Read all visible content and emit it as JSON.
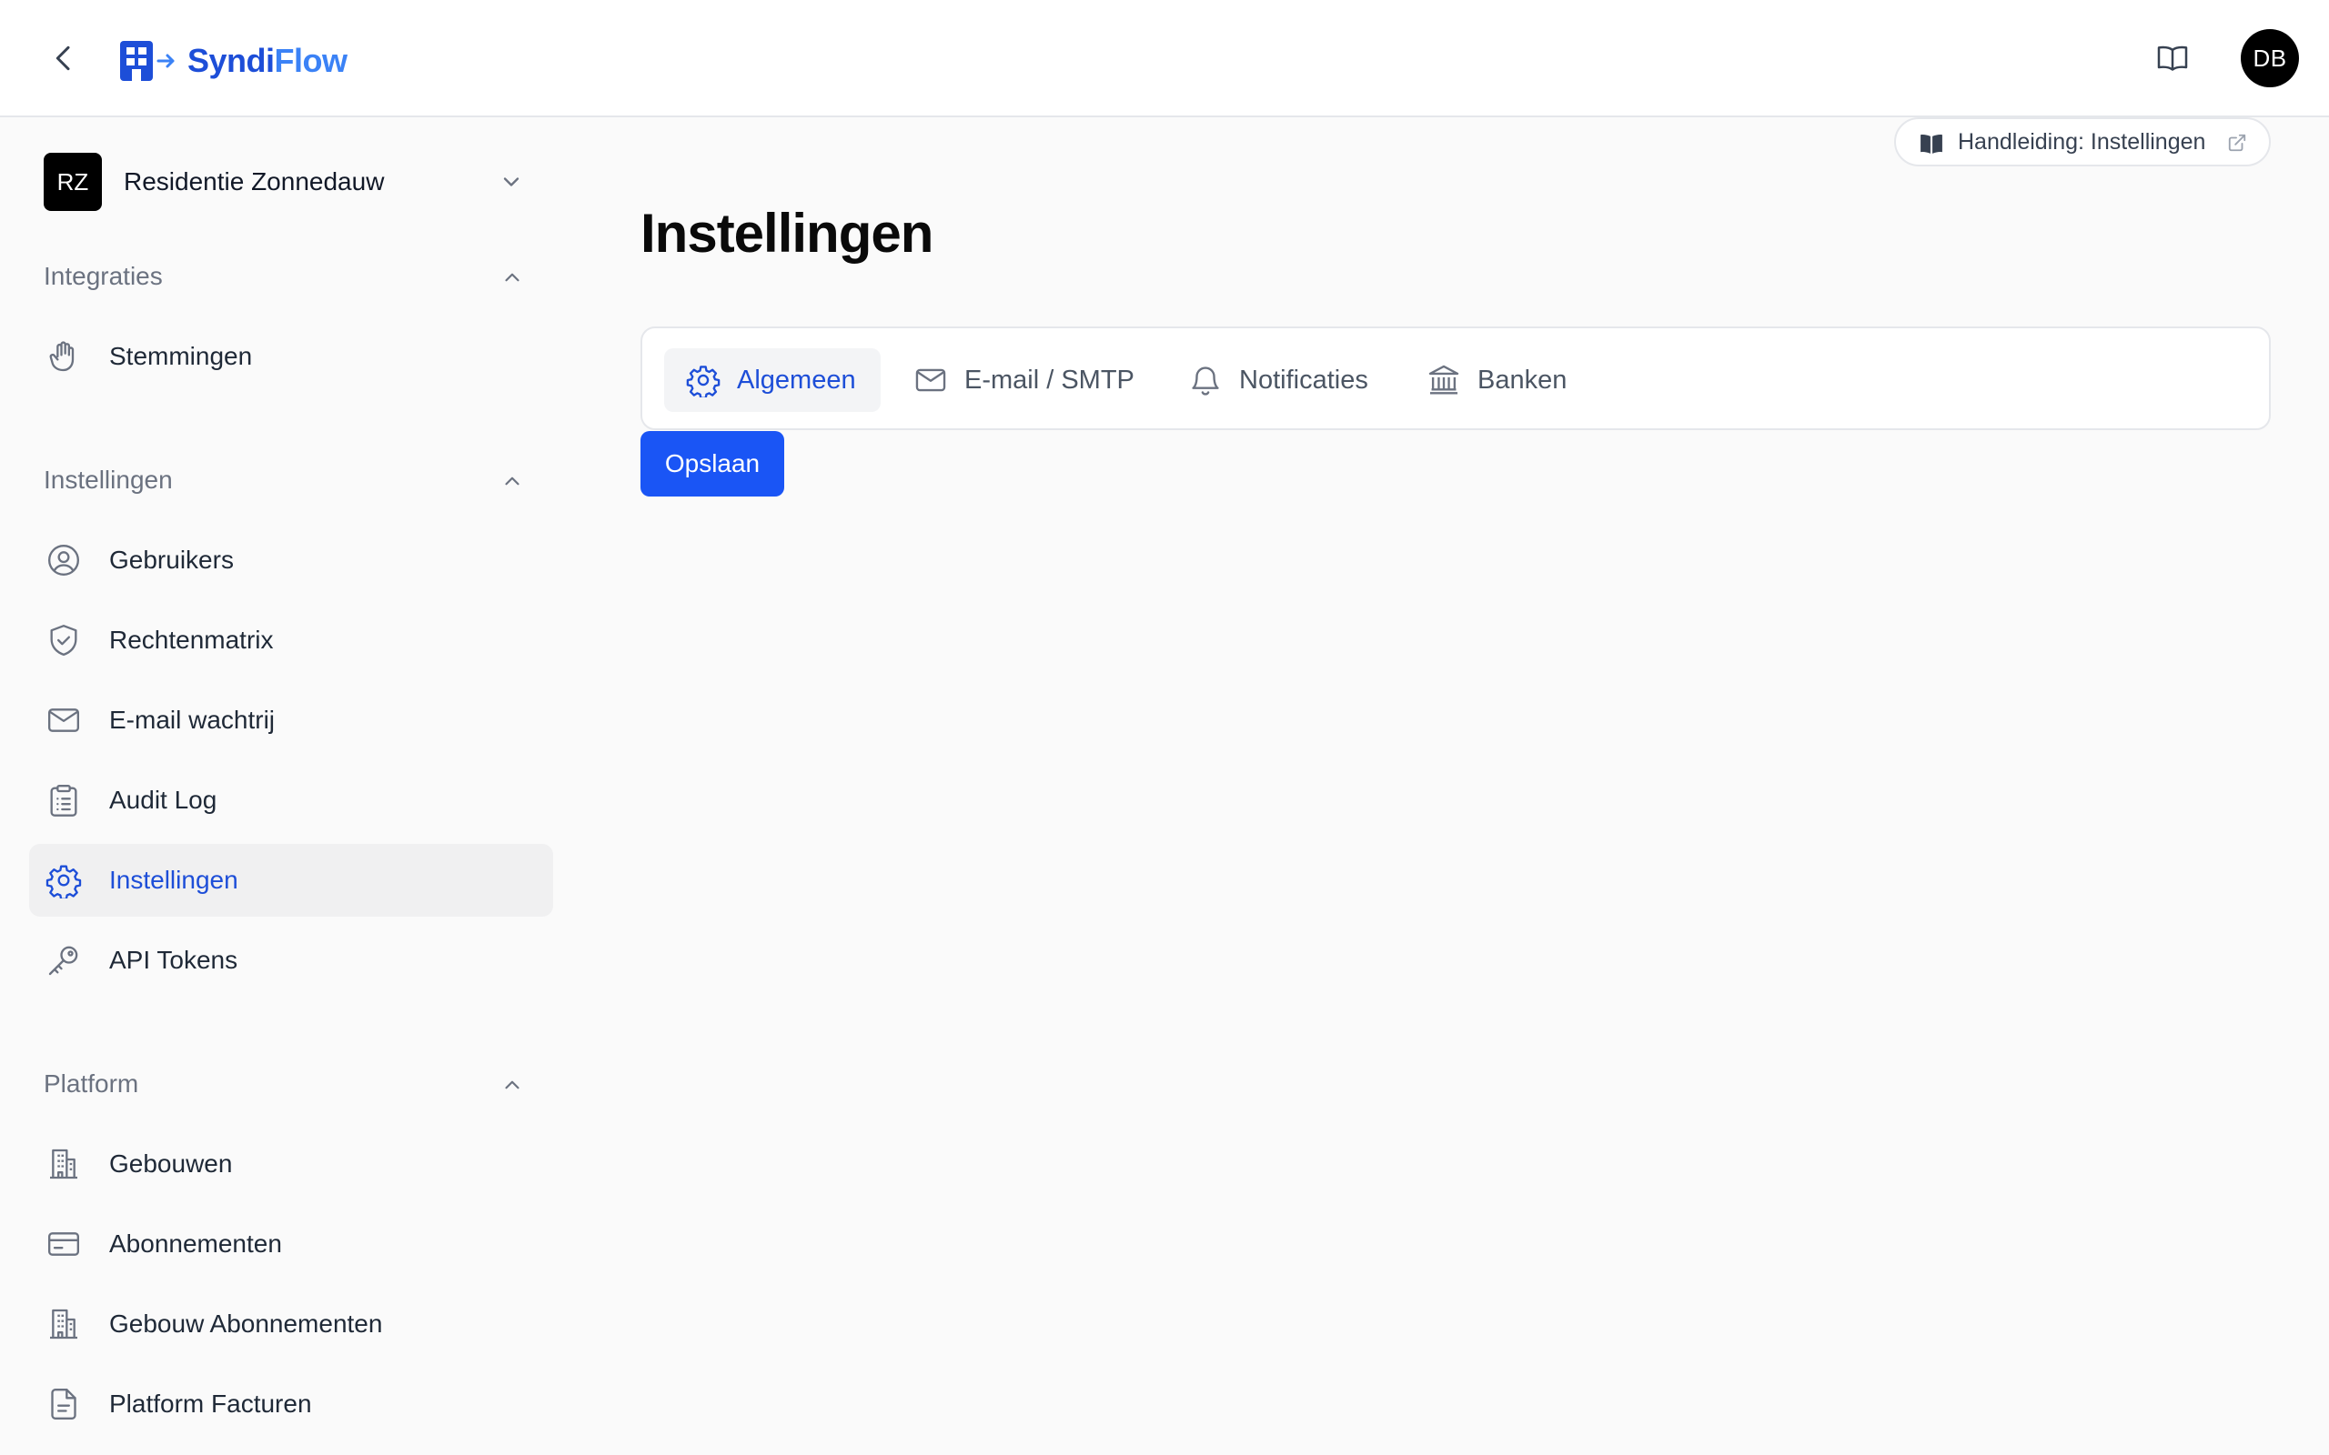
{
  "header": {
    "logo_part1": "Syndi",
    "logo_part2": "Flow",
    "avatar_initials": "DB"
  },
  "sidebar": {
    "org": {
      "initials": "RZ",
      "name": "Residentie Zonnedauw"
    },
    "sections": [
      {
        "title": "Integraties",
        "items": [
          {
            "label": "Stemmingen",
            "icon": "hand-icon"
          }
        ]
      },
      {
        "title": "Instellingen",
        "items": [
          {
            "label": "Gebruikers",
            "icon": "user-circle-icon"
          },
          {
            "label": "Rechtenmatrix",
            "icon": "shield-check-icon"
          },
          {
            "label": "E-mail wachtrij",
            "icon": "mail-icon"
          },
          {
            "label": "Audit Log",
            "icon": "clipboard-list-icon"
          },
          {
            "label": "Instellingen",
            "icon": "gear-icon",
            "active": true
          },
          {
            "label": "API Tokens",
            "icon": "key-icon"
          }
        ]
      },
      {
        "title": "Platform",
        "items": [
          {
            "label": "Gebouwen",
            "icon": "building-icon"
          },
          {
            "label": "Abonnementen",
            "icon": "credit-card-icon"
          },
          {
            "label": "Gebouw Abonnementen",
            "icon": "building-icon"
          },
          {
            "label": "Platform Facturen",
            "icon": "file-text-icon"
          }
        ]
      }
    ]
  },
  "main": {
    "manual_link": "Handleiding: Instellingen",
    "title": "Instellingen",
    "tabs": [
      {
        "label": "Algemeen",
        "icon": "gear-icon",
        "active": true
      },
      {
        "label": "E-mail / SMTP",
        "icon": "mail-icon"
      },
      {
        "label": "Notificaties",
        "icon": "bell-icon"
      },
      {
        "label": "Banken",
        "icon": "bank-icon"
      }
    ],
    "save_label": "Opslaan"
  },
  "colors": {
    "accent": "#1d4ed8",
    "primary_button": "#1a55f5",
    "active_nav_bg": "#f0f0f1"
  }
}
